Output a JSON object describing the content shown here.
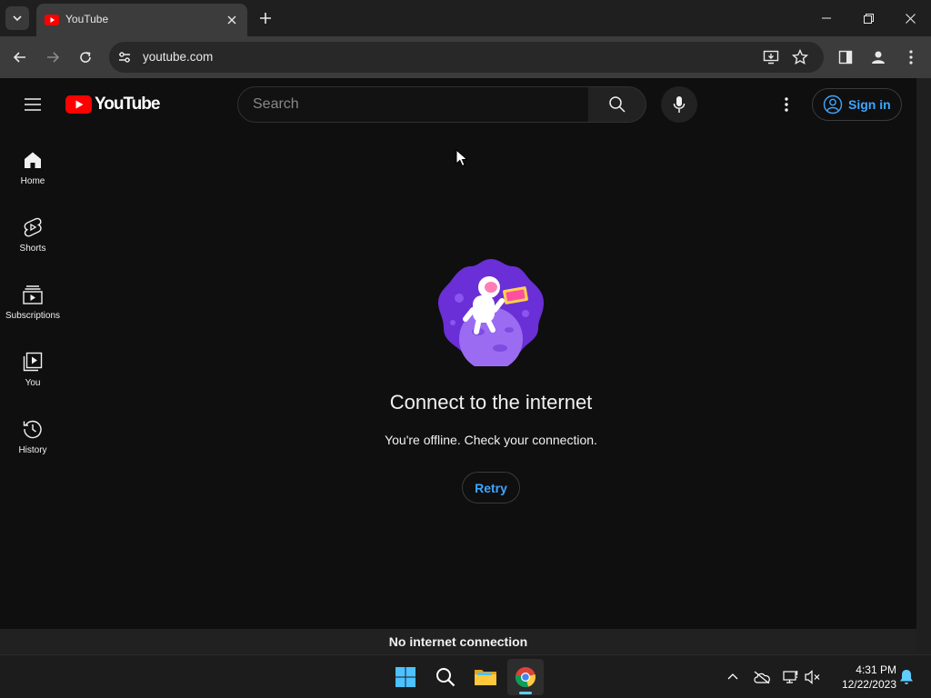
{
  "browser": {
    "tab_title": "YouTube",
    "url": "youtube.com"
  },
  "masthead": {
    "logo_text": "YouTube",
    "search_placeholder": "Search",
    "signin_label": "Sign in"
  },
  "sidebar": {
    "items": [
      {
        "label": "Home",
        "icon": "home-icon"
      },
      {
        "label": "Shorts",
        "icon": "shorts-icon"
      },
      {
        "label": "Subscriptions",
        "icon": "subscriptions-icon"
      },
      {
        "label": "You",
        "icon": "you-icon"
      },
      {
        "label": "History",
        "icon": "history-icon"
      }
    ]
  },
  "offline": {
    "title": "Connect to the internet",
    "subtitle": "You're offline. Check your connection.",
    "retry_label": "Retry"
  },
  "status_bar": {
    "message": "No internet connection"
  },
  "taskbar": {
    "time": "4:31 PM",
    "date": "12/22/2023"
  },
  "colors": {
    "background": "#0f0f0f",
    "accent_blue": "#3ea6ff",
    "youtube_red": "#ff0000"
  }
}
